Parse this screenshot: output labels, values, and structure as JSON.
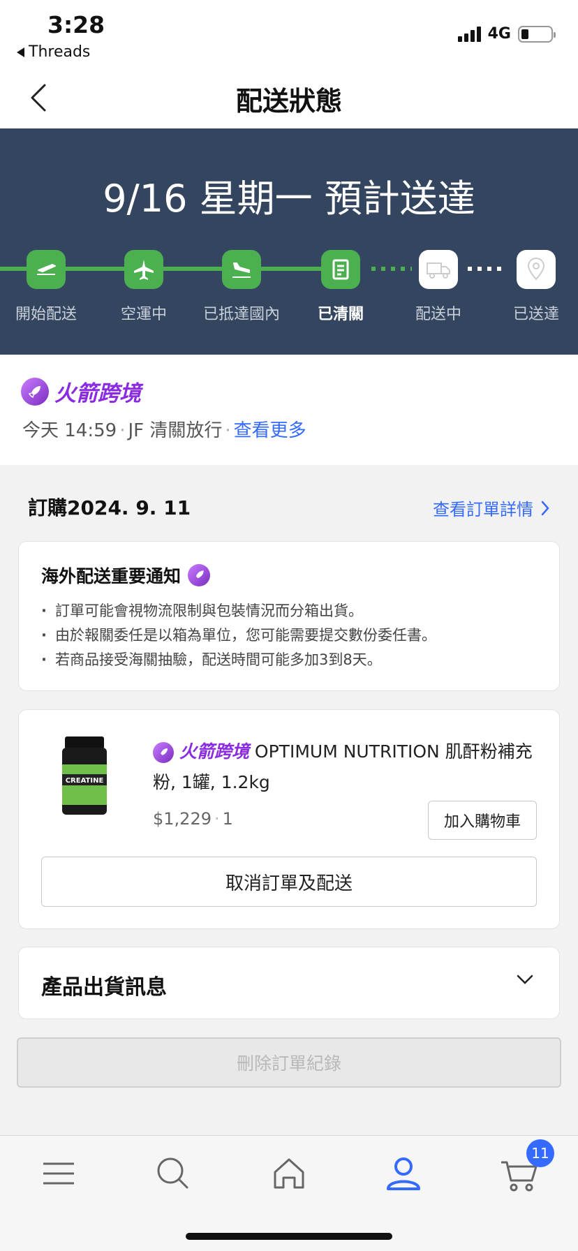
{
  "status_bar": {
    "time": "3:28",
    "back_app": "Threads",
    "network": "4G"
  },
  "header": {
    "title": "配送狀態"
  },
  "banner": {
    "eta": "9/16 星期一 預計送達",
    "steps": [
      {
        "label": "開始配送",
        "icon": "plane-takeoff-icon",
        "state": "done"
      },
      {
        "label": "空運中",
        "icon": "airplane-icon",
        "state": "done"
      },
      {
        "label": "已抵達國內",
        "icon": "plane-landing-icon",
        "state": "done"
      },
      {
        "label": "已清關",
        "icon": "document-icon",
        "state": "current"
      },
      {
        "label": "配送中",
        "icon": "truck-icon",
        "state": "todo"
      },
      {
        "label": "已送達",
        "icon": "location-pin-icon",
        "state": "todo"
      }
    ]
  },
  "carrier": {
    "brand": "火箭跨境",
    "time": "今天 14:59",
    "status": "JF 清關放行",
    "more": "查看更多"
  },
  "order": {
    "date": "訂購2024. 9. 11",
    "detail_link": "查看訂單詳情"
  },
  "notice": {
    "title": "海外配送重要通知",
    "items": [
      "訂單可能會視物流限制與包裝情況而分箱出貨。",
      "由於報關委任是以箱為單位，您可能需要提交數份委任書。",
      "若商品接受海關抽驗，配送時間可能多加3到8天。"
    ]
  },
  "product": {
    "tag": "火箭跨境",
    "name": "OPTIMUM NUTRITION 肌酐粉補充粉, 1罐, 1.2kg",
    "image_text": "CREATINE",
    "price": "$1,229",
    "quantity": "1",
    "add_to_cart": "加入購物車",
    "cancel": "取消訂單及配送"
  },
  "shipping_info": {
    "title": "產品出貨訊息"
  },
  "delete_button": "刪除訂單紀錄",
  "tabbar": {
    "cart_badge": "11"
  },
  "colors": {
    "banner_bg": "#34455f",
    "step_done": "#4caf50",
    "link": "#346aff",
    "rocket_brand": "#8a2be2"
  }
}
